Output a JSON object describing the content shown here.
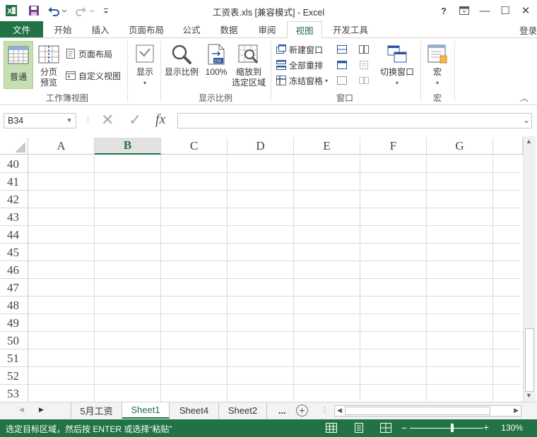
{
  "window": {
    "title": "工资表.xls  [兼容模式] - Excel",
    "help": "?",
    "ribbon_display": "▣",
    "minimize": "—",
    "maximize": "☐",
    "close": "✕"
  },
  "qat": {
    "app_icon": "excel-icon",
    "save": "save-icon",
    "undo": "undo-icon",
    "redo": "redo-icon",
    "customize": "customize-icon"
  },
  "ribbon_tabs": [
    "文件",
    "开始",
    "插入",
    "页面布局",
    "公式",
    "数据",
    "审阅",
    "视图",
    "开发工具"
  ],
  "active_tab": "视图",
  "login": "登录",
  "ribbon": {
    "workbook_views": {
      "normal": "普通",
      "page_break_line1": "分页",
      "page_break_line2": "预览",
      "page_layout": "页面布局",
      "custom_views": "自定义视图",
      "label": "工作簿视图"
    },
    "show": {
      "label": "显示",
      "arrow": "▾"
    },
    "zoom": {
      "zoom": "显示比例",
      "hundred": "100%",
      "to_selection_line1": "缩放到",
      "to_selection_line2": "选定区域",
      "label": "显示比例"
    },
    "window": {
      "new_window": "新建窗口",
      "arrange_all": "全部重排",
      "freeze_panes": "冻结窗格",
      "switch_windows": "切换窗口",
      "label": "窗口",
      "arrow": "▾"
    },
    "macros": {
      "macros": "宏",
      "label": "宏",
      "arrow": "▾"
    },
    "collapse": "︿"
  },
  "formula_bar": {
    "name_box": "B34",
    "cancel": "✕",
    "enter": "✓",
    "fx": "fx",
    "value": ""
  },
  "grid": {
    "columns": [
      "A",
      "B",
      "C",
      "D",
      "E",
      "F",
      "G"
    ],
    "selected_column": "B",
    "rows": [
      "40",
      "41",
      "42",
      "43",
      "44",
      "45",
      "46",
      "47",
      "48",
      "49",
      "50",
      "51",
      "52",
      "53"
    ]
  },
  "sheet_tabs": {
    "tabs": [
      "5月工资",
      "Sheet1",
      "Sheet4",
      "Sheet2"
    ],
    "active": "Sheet1",
    "more": "...",
    "add": "+",
    "prev": "◀",
    "next": "▶"
  },
  "status": {
    "message": "选定目标区域，然后按 ENTER 或选择“粘贴”",
    "zoom_minus": "−",
    "zoom_plus": "+",
    "zoom_level": "130%",
    "zoom_fraction": 0.6
  },
  "colors": {
    "accent": "#217346",
    "selected_header_bg": "#e1e1e1",
    "gridline": "#dcdcdc"
  }
}
